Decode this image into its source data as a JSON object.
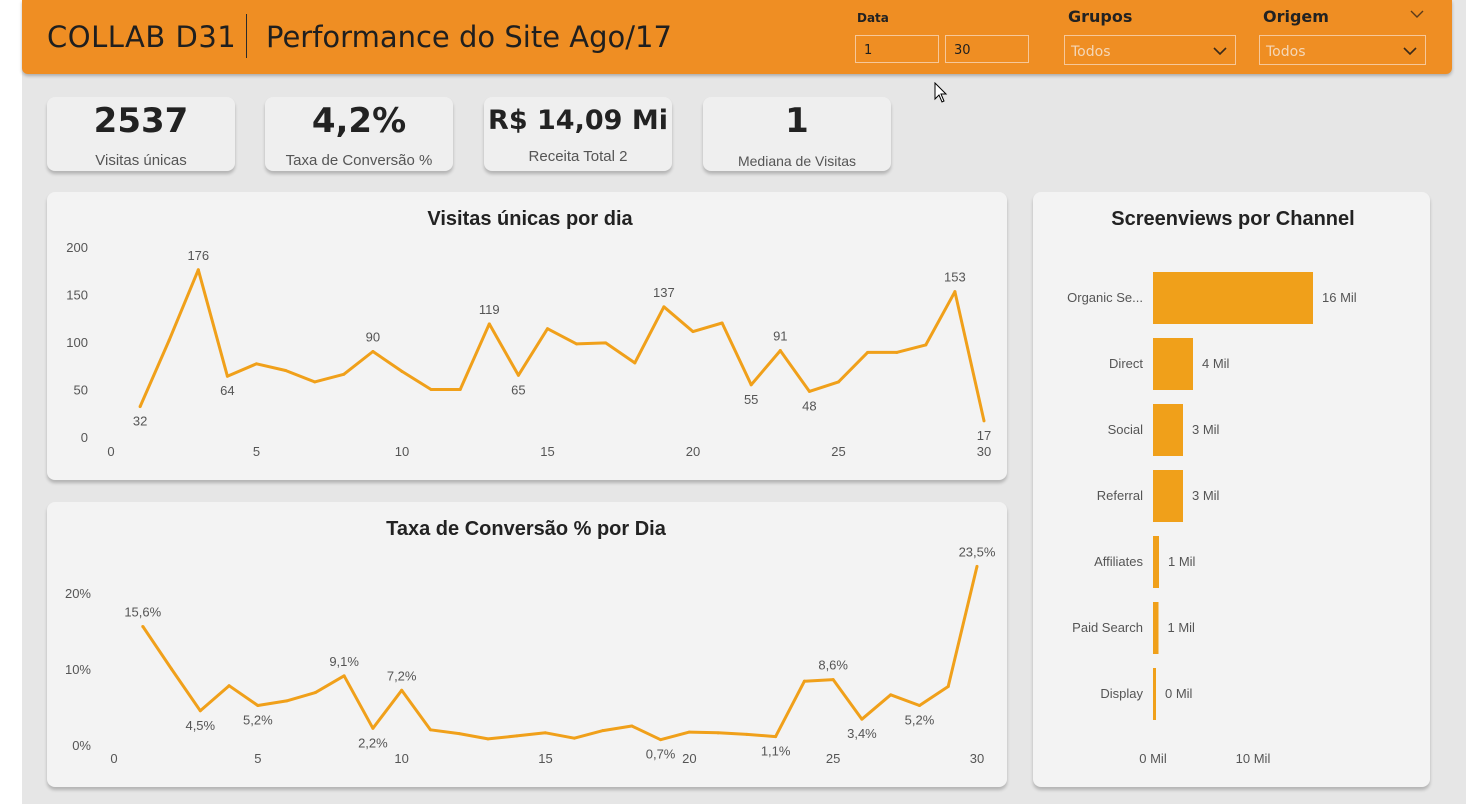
{
  "header": {
    "brand": "COLLAB D31",
    "title": "Performance do Site Ago/17",
    "filters": {
      "data_label": "Data",
      "data_start": "1",
      "data_end": "30",
      "grupos_label": "Grupos",
      "grupos_value": "Todos",
      "origem_label": "Origem",
      "origem_value": "Todos"
    }
  },
  "kpis": [
    {
      "value": "2537",
      "label": "Visitas únicas"
    },
    {
      "value": "4,2%",
      "label": "Taxa de Conversão %"
    },
    {
      "value": "R$ 14,09 Mi",
      "label": "Receita Total 2"
    },
    {
      "value": "1",
      "label": "Mediana de Visitas"
    }
  ],
  "colors": {
    "accent": "#ef8e23",
    "series": "#f0a01a"
  },
  "chart_data": [
    {
      "type": "line",
      "title": "Visitas únicas por dia",
      "x": [
        1,
        2,
        3,
        4,
        5,
        6,
        7,
        8,
        9,
        10,
        11,
        12,
        13,
        14,
        15,
        16,
        17,
        18,
        19,
        20,
        21,
        22,
        23,
        24,
        25,
        26,
        27,
        28,
        29,
        30
      ],
      "y": [
        32,
        102,
        176,
        64,
        77,
        70,
        58,
        66,
        90,
        69,
        50,
        50,
        119,
        65,
        114,
        98,
        99,
        78,
        137,
        111,
        120,
        55,
        91,
        48,
        58,
        89,
        89,
        97,
        153,
        17
      ],
      "data_labels": [
        {
          "x": 1,
          "text": "32"
        },
        {
          "x": 3,
          "text": "176"
        },
        {
          "x": 4,
          "text": "64"
        },
        {
          "x": 9,
          "text": "90"
        },
        {
          "x": 13,
          "text": "119"
        },
        {
          "x": 14,
          "text": "65"
        },
        {
          "x": 19,
          "text": "137"
        },
        {
          "x": 22,
          "text": "55"
        },
        {
          "x": 23,
          "text": "91"
        },
        {
          "x": 24,
          "text": "48"
        },
        {
          "x": 29,
          "text": "153"
        },
        {
          "x": 30,
          "text": "17"
        }
      ],
      "x_ticks": [
        "0",
        "5",
        "10",
        "15",
        "20",
        "25",
        "30"
      ],
      "y_ticks": [
        "0",
        "50",
        "100",
        "150",
        "200"
      ],
      "xlim": [
        0,
        30
      ],
      "ylim": [
        0,
        200
      ],
      "grid": false
    },
    {
      "type": "line",
      "title": "Taxa de Conversão % por Dia",
      "x": [
        1,
        2,
        3,
        4,
        5,
        6,
        7,
        8,
        9,
        10,
        11,
        12,
        13,
        14,
        15,
        16,
        17,
        18,
        19,
        20,
        21,
        22,
        23,
        24,
        25,
        26,
        27,
        28,
        29,
        30
      ],
      "y": [
        15.6,
        10.0,
        4.5,
        7.8,
        5.2,
        5.8,
        6.9,
        9.1,
        2.2,
        7.2,
        2.0,
        1.5,
        0.8,
        1.2,
        1.6,
        0.9,
        1.9,
        2.5,
        0.7,
        1.7,
        1.6,
        1.4,
        1.1,
        8.4,
        8.6,
        3.4,
        6.6,
        5.2,
        7.7,
        23.5
      ],
      "data_labels": [
        {
          "x": 1,
          "text": "15,6%"
        },
        {
          "x": 3,
          "text": "4,5%"
        },
        {
          "x": 5,
          "text": "5,2%"
        },
        {
          "x": 8,
          "text": "9,1%"
        },
        {
          "x": 9,
          "text": "2,2%"
        },
        {
          "x": 10,
          "text": "7,2%"
        },
        {
          "x": 19,
          "text": "0,7%"
        },
        {
          "x": 23,
          "text": "1,1%"
        },
        {
          "x": 25,
          "text": "8,6%"
        },
        {
          "x": 26,
          "text": "3,4%"
        },
        {
          "x": 28,
          "text": "5,2%"
        },
        {
          "x": 30,
          "text": "23,5%"
        }
      ],
      "x_ticks": [
        "0",
        "5",
        "10",
        "15",
        "20",
        "25",
        "30"
      ],
      "y_ticks": [
        "0%",
        "10%",
        "20%"
      ],
      "xlim": [
        0,
        30
      ],
      "ylim": [
        0,
        20
      ],
      "grid": false
    },
    {
      "type": "bar",
      "orientation": "horizontal",
      "title": "Screenviews por Channel",
      "categories": [
        "Organic Se...",
        "Direct",
        "Social",
        "Referral",
        "Affiliates",
        "Paid Search",
        "Display"
      ],
      "values": [
        16,
        4,
        3,
        3,
        0.6,
        0.55,
        0.3
      ],
      "value_labels": [
        "16 Mil",
        "4 Mil",
        "3 Mil",
        "3 Mil",
        "1 Mil",
        "1 Mil",
        "0 Mil"
      ],
      "x_ticks": [
        "0 Mil",
        "10 Mil"
      ],
      "xlim": [
        0,
        20
      ],
      "unit": "Mil",
      "grid": false
    }
  ]
}
